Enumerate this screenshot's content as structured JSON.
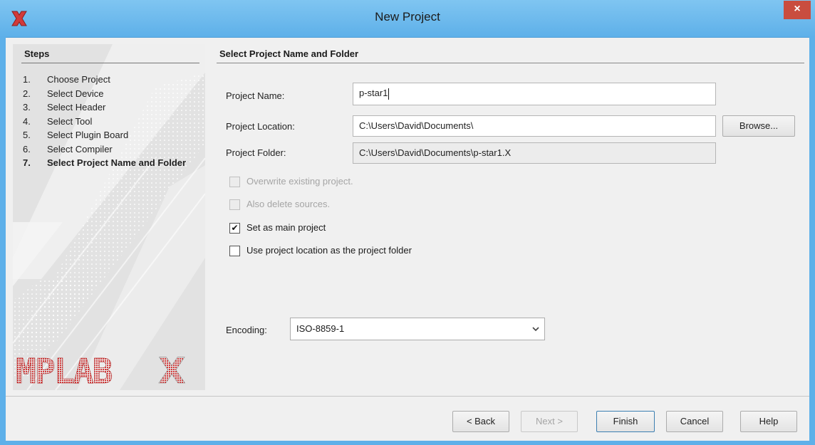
{
  "window": {
    "title": "New Project",
    "close_glyph": "×",
    "app_icon": "mplab-x-icon"
  },
  "sidebar": {
    "title": "Steps",
    "steps": [
      {
        "num": "1.",
        "label": "Choose Project"
      },
      {
        "num": "2.",
        "label": "Select Device"
      },
      {
        "num": "3.",
        "label": "Select Header"
      },
      {
        "num": "4.",
        "label": "Select Tool"
      },
      {
        "num": "5.",
        "label": "Select Plugin Board"
      },
      {
        "num": "6.",
        "label": "Select Compiler"
      },
      {
        "num": "7.",
        "label": "Select Project Name and Folder",
        "current": true
      }
    ],
    "logo_text": "MPLAB X"
  },
  "form": {
    "section_title": "Select Project Name and Folder",
    "project_name_label": "Project Name:",
    "project_name_value": "p-star1",
    "project_location_label": "Project Location:",
    "project_location_value": "C:\\Users\\David\\Documents\\",
    "browse_label": "Browse...",
    "project_folder_label": "Project Folder:",
    "project_folder_value": "C:\\Users\\David\\Documents\\p-star1.X",
    "checkboxes": [
      {
        "label": "Overwrite existing project.",
        "checked": false,
        "enabled": false
      },
      {
        "label": "Also delete sources.",
        "checked": false,
        "enabled": false
      },
      {
        "label": "Set as main project",
        "checked": true,
        "enabled": true
      },
      {
        "label": "Use project location as the project folder",
        "checked": false,
        "enabled": true
      }
    ],
    "encoding_label": "Encoding:",
    "encoding_value": "ISO-8859-1"
  },
  "buttons": {
    "back": "< Back",
    "next": "Next >",
    "finish": "Finish",
    "cancel": "Cancel",
    "help": "Help"
  },
  "colors": {
    "titlebar": "#5eb0e9",
    "close": "#c94d3f",
    "logo_red": "#d23a3a"
  }
}
